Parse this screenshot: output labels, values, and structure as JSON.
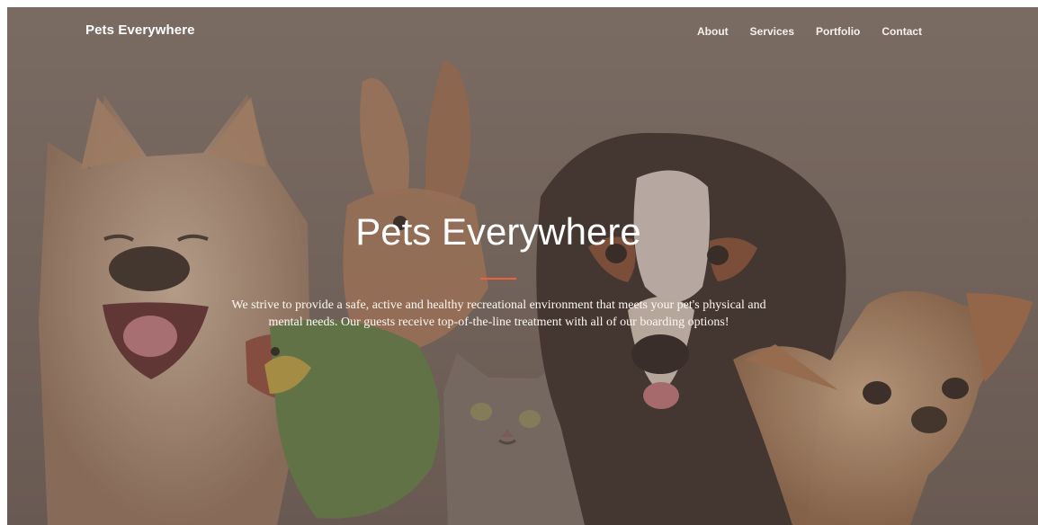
{
  "brand": {
    "name": "Pets Everywhere"
  },
  "nav": {
    "items": [
      "About",
      "Services",
      "Portfolio",
      "Contact"
    ]
  },
  "hero": {
    "title": "Pets Everywhere",
    "description": "We strive to provide a safe, active and healthy recreational environment that meets your pet's physical and mental needs. Our guests receive top-of-the-line treatment with all of our boarding options!",
    "accent_color": "#f05f40",
    "overlay_color": "#7b6d64",
    "background_subject": "dog, rabbit, parrot, kitten, puppy and chihuahua group photo"
  }
}
